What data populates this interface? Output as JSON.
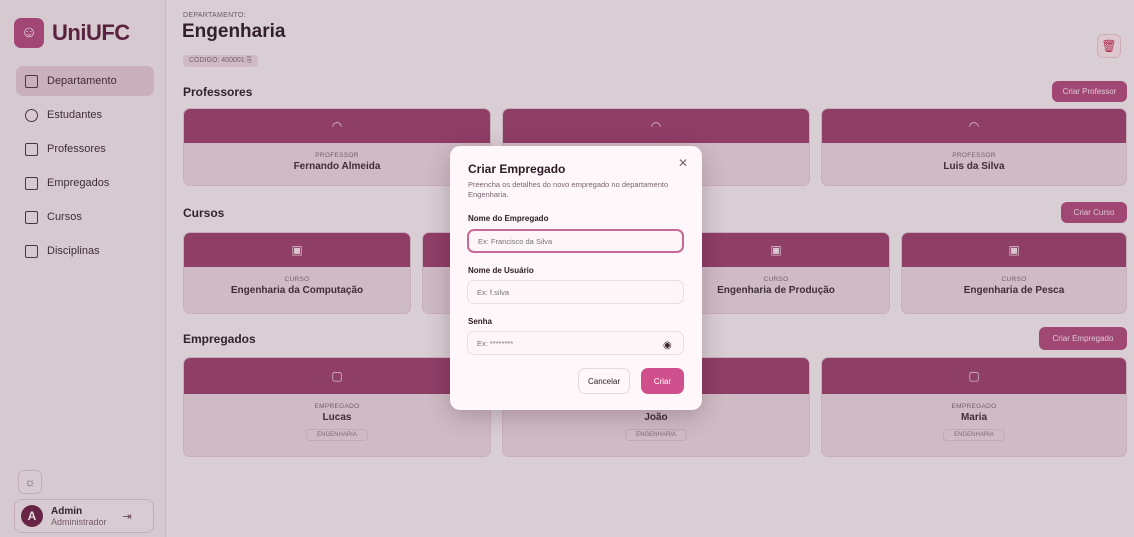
{
  "app": {
    "name": "UniUFC",
    "logo_icon": "logo-icon"
  },
  "sidebar": {
    "items": [
      {
        "label": "Departamento",
        "icon": "building-icon",
        "active": true
      },
      {
        "label": "Estudantes",
        "icon": "user-icon",
        "active": false
      },
      {
        "label": "Professores",
        "icon": "graduation-cap-icon",
        "active": false
      },
      {
        "label": "Empregados",
        "icon": "id-badge-icon",
        "active": false
      },
      {
        "label": "Cursos",
        "icon": "book-icon",
        "active": false
      },
      {
        "label": "Disciplinas",
        "icon": "grid-icon",
        "active": false
      }
    ],
    "user": {
      "initial": "A",
      "name": "Admin",
      "role": "Administrador"
    }
  },
  "header": {
    "label": "DEPARTAMENTO:",
    "title": "Engenharia",
    "code": "CÓDIGO: 400001"
  },
  "sections": {
    "professores": {
      "title": "Professores",
      "button": "Criar Professor",
      "cards": [
        {
          "kind": "PROFESSOR",
          "name": "Fernando Almeida"
        },
        {
          "kind": "PROFESSOR",
          "name": ""
        },
        {
          "kind": "PROFESSOR",
          "name": "Luis da Silva"
        }
      ]
    },
    "cursos": {
      "title": "Cursos",
      "button": "Criar Curso",
      "cards": [
        {
          "kind": "CURSO",
          "name": "Engenharia da Computação"
        },
        {
          "kind": "CURSO",
          "name": ""
        },
        {
          "kind": "CURSO",
          "name": "Engenharia de Produção"
        },
        {
          "kind": "CURSO",
          "name": "Engenharia de Pesca"
        }
      ]
    },
    "empregados": {
      "title": "Empregados",
      "button": "Criar Empregado",
      "cards": [
        {
          "kind": "EMPREGADO",
          "name": "Lucas",
          "badge": "ENGENHARIA"
        },
        {
          "kind": "EMPREGADO",
          "name": "João",
          "badge": "ENGENHARIA"
        },
        {
          "kind": "EMPREGADO",
          "name": "Maria",
          "badge": "ENGENHARIA"
        }
      ]
    }
  },
  "modal": {
    "title": "Criar Empregado",
    "description": "Preencha os detalhes do novo empregado no departamento Engenharia.",
    "fields": {
      "name": {
        "label": "Nome do Empregado",
        "placeholder": "Ex: Francisco da Silva"
      },
      "username": {
        "label": "Nome de Usuário",
        "placeholder": "Ex: f.silva"
      },
      "password": {
        "label": "Senha",
        "placeholder": "Ex: ********"
      }
    },
    "cancel": "Cancelar",
    "submit": "Criar"
  },
  "colors": {
    "accent": "#9c3f6c",
    "primary_button": "#d04f8d",
    "danger": "#c0264b"
  }
}
